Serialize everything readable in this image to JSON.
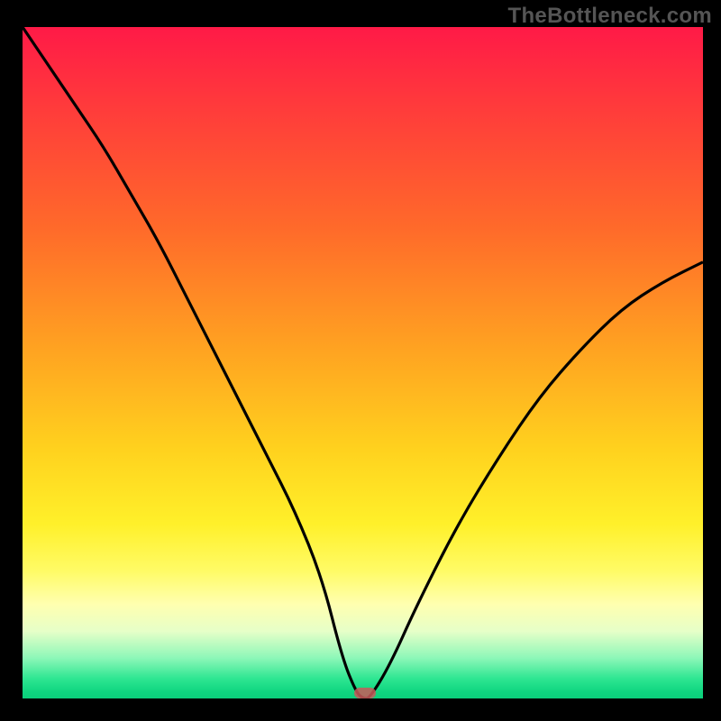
{
  "attribution": "TheBottleneck.com",
  "colors": {
    "curve": "#000000",
    "marker": "#c85a5a",
    "frame": "#000000"
  },
  "chart_data": {
    "type": "line",
    "title": "",
    "xlabel": "",
    "ylabel": "",
    "xlim": [
      0,
      100
    ],
    "ylim": [
      0,
      100
    ],
    "series": [
      {
        "name": "bottleneck-curve",
        "x": [
          0,
          4,
          8,
          12,
          16,
          20,
          24,
          28,
          32,
          36,
          40,
          44,
          47,
          49,
          50,
          51,
          54,
          58,
          64,
          70,
          76,
          82,
          88,
          94,
          100
        ],
        "y": [
          100,
          94,
          88,
          82,
          75,
          68,
          60,
          52,
          44,
          36,
          28,
          18,
          6,
          1,
          0,
          0,
          5,
          14,
          26,
          36,
          45,
          52,
          58,
          62,
          65
        ]
      }
    ],
    "marker": {
      "x": 50.3,
      "y": 0.8
    },
    "grid": false,
    "legend": false
  }
}
